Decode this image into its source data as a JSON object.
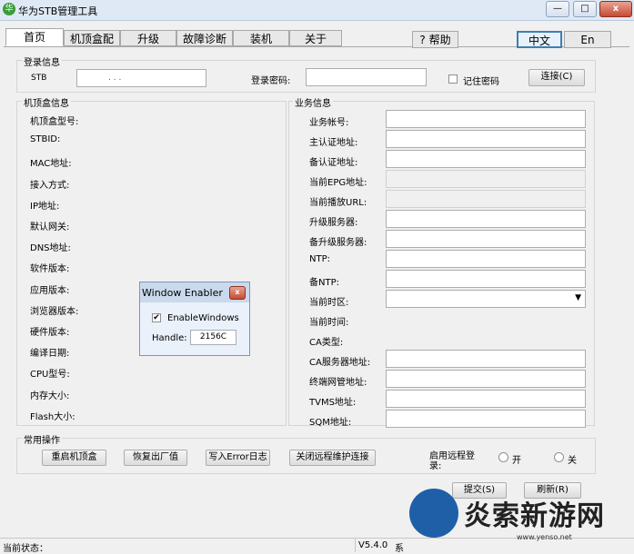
{
  "window": {
    "title": "华为STB管理工具",
    "app_icon_glyph": "华",
    "minimize": "—",
    "maximize": "□",
    "close": "x"
  },
  "tabs": [
    "首页",
    "机顶盒配",
    "升级",
    "故障诊断",
    "装机",
    "关于"
  ],
  "help_button": "? 帮助",
  "lang": {
    "zh": "中文",
    "en": "En"
  },
  "login": {
    "group_title": "登录信息",
    "stb_label": "STB",
    "ip_value": ".      .      .",
    "password_label": "登录密码:",
    "remember_label": "记住密码",
    "connect_button": "连接(C)"
  },
  "stb_info": {
    "group_title": "机顶盒信息",
    "fields": [
      "机顶盒型号:",
      "STBID:",
      "MAC地址:",
      "接入方式:",
      "IP地址:",
      "默认网关:",
      "DNS地址:",
      "软件版本:",
      "应用版本:",
      "浏览器版本:",
      "硬件版本:",
      "编译日期:",
      "CPU型号:",
      "内存大小:",
      "Flash大小:"
    ]
  },
  "biz_info": {
    "group_title": "业务信息",
    "fields": [
      "业务帐号:",
      "主认证地址:",
      "备认证地址:",
      "当前EPG地址:",
      "当前播放URL:",
      "升级服务器:",
      "备升级服务器:",
      "NTP:",
      "备NTP:",
      "当前时区:",
      "当前时间:",
      "CA类型:",
      "CA服务器地址:",
      "终端网管地址:",
      "TVMS地址:",
      "SQM地址:"
    ]
  },
  "common_ops": {
    "group_title": "常用操作",
    "buttons": [
      "重启机顶盒",
      "恢复出厂值",
      "写入Error日志",
      "关闭远程维护连接"
    ],
    "remote_login_label": "启用远程登录:",
    "on": "开",
    "off": "关"
  },
  "submit_button": "提交(S)",
  "refresh_button": "刷新(R)",
  "status": {
    "label": "当前状态：",
    "version": "V5.4.0",
    "extra": "系"
  },
  "dialog": {
    "title": "Window Enabler",
    "checkbox_label": "EnableWindows",
    "handle_label": "Handle:",
    "handle_value": "2156C"
  },
  "watermark": {
    "text": "炎索新游网",
    "url": "www.yenso.net"
  }
}
